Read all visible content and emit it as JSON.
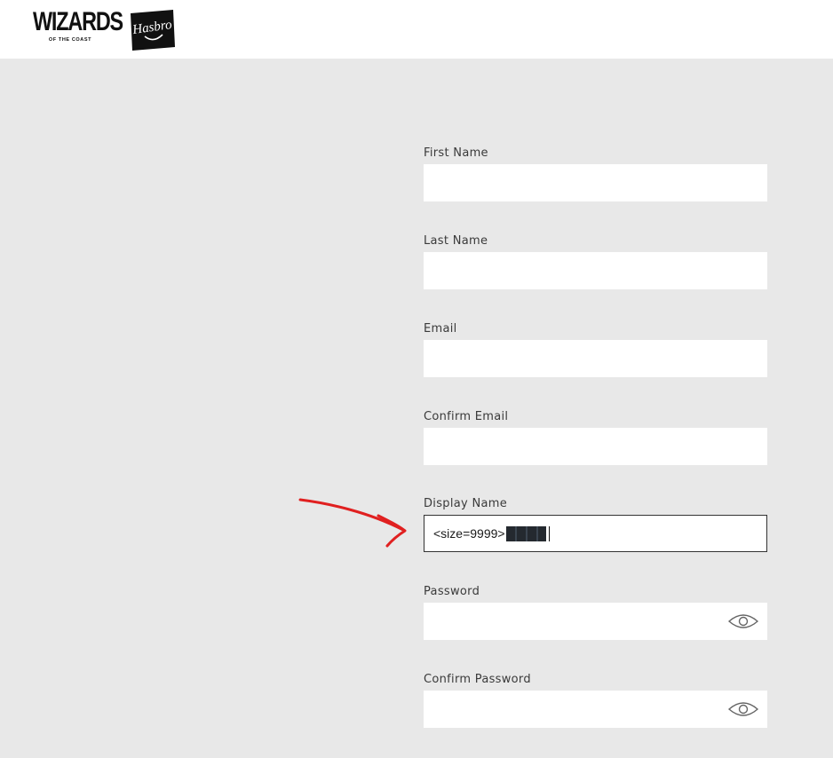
{
  "header": {
    "wizards_logo": {
      "main": "WIZARDS",
      "sub": "OF THE COAST"
    },
    "hasbro_logo": {
      "text": "Hasbro"
    }
  },
  "form": {
    "first_name": {
      "label": "First Name",
      "value": ""
    },
    "last_name": {
      "label": "Last Name",
      "value": ""
    },
    "email": {
      "label": "Email",
      "value": ""
    },
    "confirm_email": {
      "label": "Confirm Email",
      "value": ""
    },
    "display_name": {
      "label": "Display Name",
      "value": "<size=9999>"
    },
    "password": {
      "label": "Password",
      "value": "",
      "toggle_icon": "eye-icon"
    },
    "confirm_password": {
      "label": "Confirm Password",
      "value": "",
      "toggle_icon": "eye-icon"
    }
  },
  "annotation": {
    "color": "#e02020",
    "icon": "arrow-icon"
  }
}
